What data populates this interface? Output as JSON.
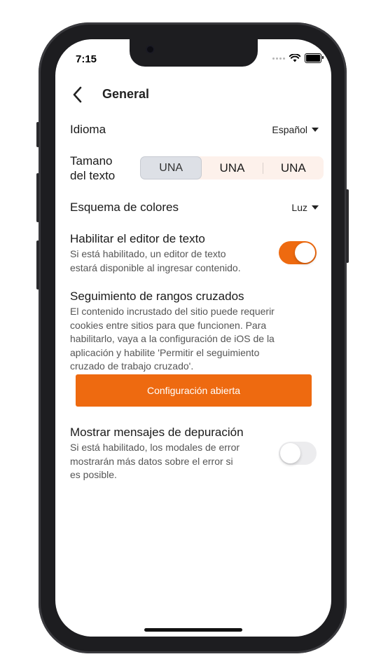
{
  "status_bar": {
    "time": "7:15"
  },
  "header": {
    "title": "General"
  },
  "language": {
    "label": "Idioma",
    "value": "Español"
  },
  "text_size": {
    "label_line1": "Tamano",
    "label_line2": "del texto",
    "options": [
      "UNA",
      "UNA",
      "UNA"
    ],
    "selected_index": 0
  },
  "color_scheme": {
    "label": "Esquema de colores",
    "value": "Luz"
  },
  "text_editor": {
    "title": "Habilitar el editor de texto",
    "desc_line1": "Si está habilitado, un editor de texto",
    "desc_line2": "estará disponible al ingresar contenido.",
    "enabled": true
  },
  "cross_tracking": {
    "title": "Seguimiento de rangos cruzados",
    "desc_line1": "El contenido incrustado del sitio puede requerir",
    "desc_line2": "cookies entre sitios para que funcionen. Para",
    "desc_line3": "habilitarlo, vaya a la configuración de iOS de la",
    "desc_line4": "aplicación y habilite 'Permitir el seguimiento",
    "desc_line5": "cruzado de trabajo cruzado'.",
    "button_label": "Configuración abierta"
  },
  "debug": {
    "title": "Mostrar mensajes de depuración",
    "desc_line1": "Si está habilitado, los modales de error",
    "desc_line2": "mostrarán más datos sobre el error si",
    "desc_line3": "es posible.",
    "enabled": false
  },
  "colors": {
    "accent": "#ee6a10",
    "segment_bg": "#fdf1eb",
    "segment_selected": "#dde0e6"
  }
}
